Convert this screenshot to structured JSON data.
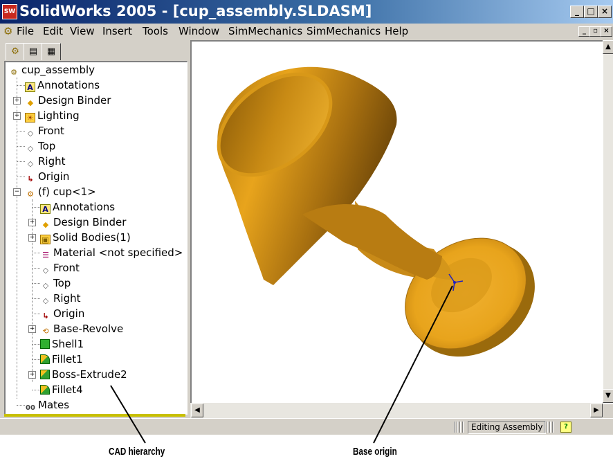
{
  "window": {
    "title": "SolidWorks 2005 - [cup_assembly.SLDASM]",
    "app_icon_label": "SW",
    "controls": [
      "_",
      "□",
      "×"
    ],
    "mdi_controls": [
      "_",
      "▫",
      "×"
    ]
  },
  "menu": {
    "items": [
      "File",
      "Edit",
      "View",
      "Insert",
      "Tools",
      "Window",
      "SimMechanics",
      "SimMechanics",
      "Help"
    ]
  },
  "tabs": [
    "feature-manager",
    "property-manager",
    "configuration-manager"
  ],
  "tree": {
    "items": [
      {
        "label": "cup_assembly",
        "icon": "assembly-icon"
      },
      {
        "label": "Annotations",
        "icon": "annotations-icon"
      },
      {
        "label": "Design Binder",
        "icon": "design-binder-icon"
      },
      {
        "label": "Lighting",
        "icon": "lighting-icon"
      },
      {
        "label": "Front",
        "icon": "plane-icon"
      },
      {
        "label": "Top",
        "icon": "plane-icon"
      },
      {
        "label": "Right",
        "icon": "plane-icon"
      },
      {
        "label": "Origin",
        "icon": "origin-icon"
      },
      {
        "label": "(f) cup<1>",
        "icon": "part-icon"
      },
      {
        "label": "Annotations",
        "icon": "annotations-icon"
      },
      {
        "label": "Design Binder",
        "icon": "design-binder-icon"
      },
      {
        "label": "Solid Bodies(1)",
        "icon": "solid-bodies-icon"
      },
      {
        "label": "Material <not specified>",
        "icon": "material-icon"
      },
      {
        "label": "Front",
        "icon": "plane-icon"
      },
      {
        "label": "Top",
        "icon": "plane-icon"
      },
      {
        "label": "Right",
        "icon": "plane-icon"
      },
      {
        "label": "Origin",
        "icon": "origin-icon"
      },
      {
        "label": "Base-Revolve",
        "icon": "revolve-icon"
      },
      {
        "label": "Shell1",
        "icon": "shell-icon"
      },
      {
        "label": "Fillet1",
        "icon": "fillet-icon"
      },
      {
        "label": "Boss-Extrude2",
        "icon": "extrude-icon"
      },
      {
        "label": "Fillet4",
        "icon": "fillet-icon"
      },
      {
        "label": "Mates",
        "icon": "mates-icon"
      }
    ]
  },
  "status": {
    "text": "Editing Assembly",
    "help": "?"
  },
  "captions": {
    "tree": "CAD hierarchy",
    "origin": "Base origin"
  },
  "colors": {
    "model": "#e8a41c",
    "titlebar": "#0a246a"
  }
}
